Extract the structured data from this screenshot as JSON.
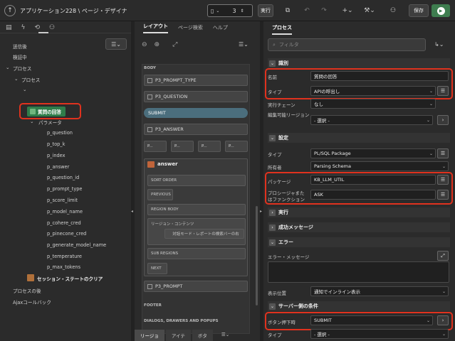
{
  "header": {
    "breadcrumb": "アプリケーション228 \\ ページ・デザイナ",
    "page_number": "3",
    "run_label": "実行",
    "save_label": "保存"
  },
  "left": {
    "items": [
      {
        "label": "送信後"
      },
      {
        "label": "検証中"
      },
      {
        "label": "プロセス"
      },
      {
        "label": "プロセス"
      },
      {
        "label": "パラメータ"
      },
      {
        "label": "p_question"
      },
      {
        "label": "p_top_k"
      },
      {
        "label": "p_index"
      },
      {
        "label": "p_answer"
      },
      {
        "label": "p_question_id"
      },
      {
        "label": "p_prompt_type"
      },
      {
        "label": "p_score_limit"
      },
      {
        "label": "p_model_name"
      },
      {
        "label": "p_cohere_cred"
      },
      {
        "label": "p_pinecone_cred"
      },
      {
        "label": "p_generate_model_name"
      },
      {
        "label": "p_temperature"
      },
      {
        "label": "p_max_tokens"
      },
      {
        "label": "セッション・ステートのクリア"
      },
      {
        "label": "プロセスの後"
      },
      {
        "label": "Ajaxコールバック"
      }
    ],
    "selected": "質問の回答"
  },
  "middle": {
    "tabs": [
      "レイアウト",
      "ページ検索",
      "ヘルプ"
    ],
    "body_label": "BODY",
    "components": [
      "P3_PROMPT_TYPE",
      "P3_QUESTION",
      "P3_ANSWER",
      "P3_PROMPT"
    ],
    "submit": "SUBMIT",
    "small_buttons": [
      "P...",
      "P...",
      "P...",
      "P..."
    ],
    "region_title": "answer",
    "slots": [
      "SORT ORDER",
      "PREVIOUS",
      "REGION BODY",
      "リージョン・コンテンツ",
      "SUB REGIONS",
      "NEXT"
    ],
    "region_note": "対話モード・レポートの検索バーの右",
    "footer": "FOOTER",
    "dialogs": "DIALOGS, DRAWERS AND POPUPS",
    "bottom_tabs": [
      "リージョ",
      "アイテ",
      "ボタ"
    ]
  },
  "right": {
    "tab": "プロセス",
    "filter_placeholder": "フィルタ",
    "sections": {
      "identify": "識別",
      "settings": "設定",
      "execute": "実行",
      "success": "成功メッセージ",
      "error": "エラー",
      "server": "サーバー側の条件"
    },
    "props": {
      "name_label": "名前",
      "name_value": "質問の回答",
      "type_label": "タイプ",
      "type_value": "APIの呼出し",
      "chain_label": "実行チェーン",
      "chain_value": "なし",
      "editable_label": "編集可能リージョン",
      "editable_value": "- 選択 -",
      "settings_type_label": "タイプ",
      "settings_type_value": "PL/SQL Package",
      "owner_label": "所有者",
      "owner_value": "Parsing Schema",
      "package_label": "パッケージ",
      "package_value": "KB_LLM_UTIL",
      "proc_label1": "プロシージャまた",
      "proc_label2": "はファンクション",
      "proc_value": "ASK",
      "errmsg_label": "エラー・メッセージ",
      "display_label": "表示位置",
      "display_value": "通知でインライン表示",
      "button_label": "ボタン押下時",
      "button_value": "SUBMIT",
      "server_type_label": "タイプ",
      "server_type_value": "- 選択 -"
    }
  }
}
